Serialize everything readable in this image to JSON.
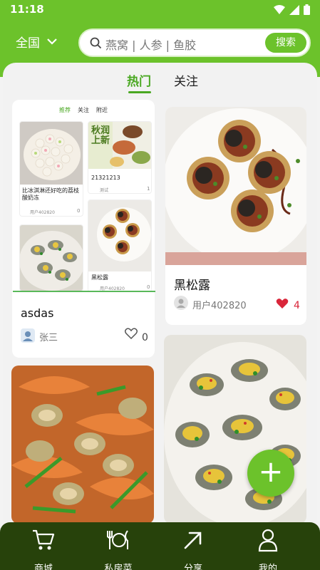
{
  "status_bar": {
    "time": "11:18"
  },
  "header": {
    "region": "全国",
    "search_placeholder": "燕窝 | 人参 | 鱼胶",
    "search_button": "搜索"
  },
  "tabs": {
    "hot": "热门",
    "follow": "关注"
  },
  "preview_card": {
    "mini_tabs": [
      "推荐",
      "关注",
      "附近"
    ],
    "mini_items": [
      {
        "title": "比冰淇淋还好吃的荔枝酸奶冻",
        "user": "用户402820",
        "likes": "0"
      },
      {
        "title": "21321213",
        "user": "测试",
        "likes": "1"
      },
      {
        "title": "黑松露",
        "user": "用户402820",
        "likes": "0"
      }
    ],
    "banner_text": "秋润上新",
    "title": "asdas",
    "author": "张三",
    "likes": "0"
  },
  "truffle_card": {
    "title": "黑松露",
    "user": "用户402820",
    "likes": "4"
  },
  "fab": {
    "label": "+"
  },
  "bottom_nav": {
    "items": [
      {
        "label": "商城",
        "icon": "cart-icon"
      },
      {
        "label": "私房菜",
        "icon": "utensils-icon"
      },
      {
        "label": "分享",
        "icon": "share-arrow-icon"
      },
      {
        "label": "我的",
        "icon": "person-icon"
      }
    ]
  },
  "colors": {
    "brand_green": "#6cc22b",
    "nav_dark": "#27420b",
    "like_red": "#d9263a"
  }
}
